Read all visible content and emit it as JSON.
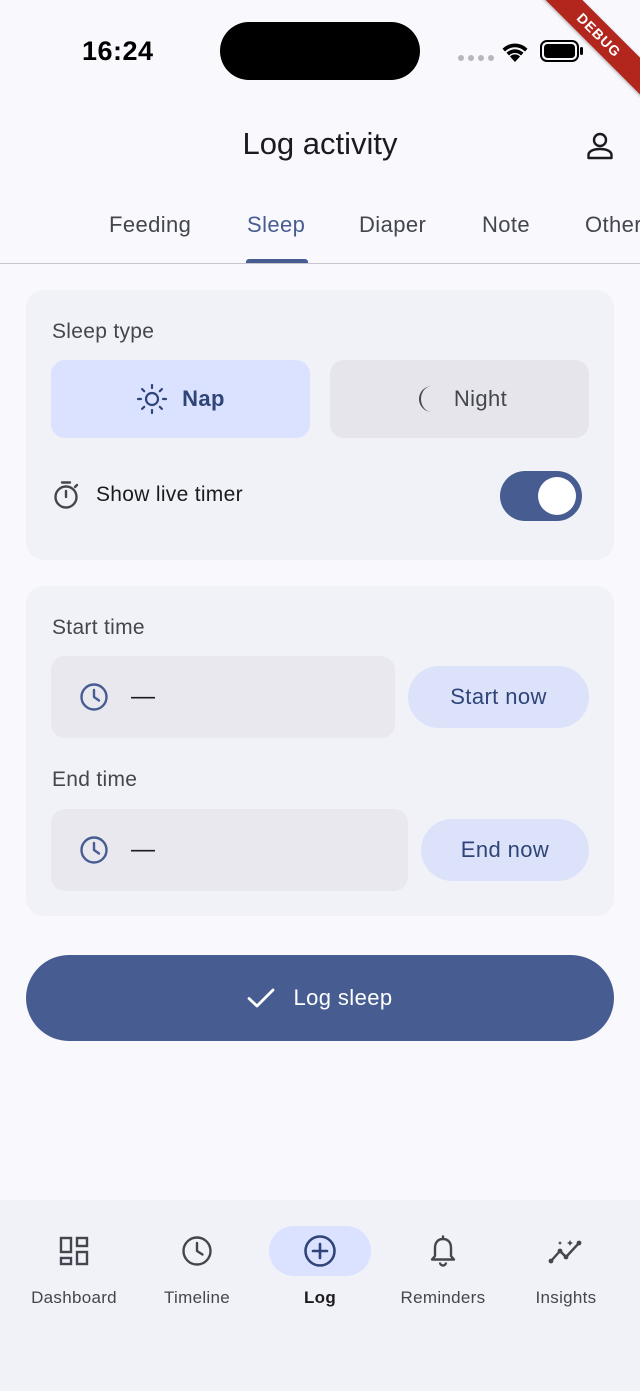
{
  "status_bar": {
    "time": "16:24",
    "debug_label": "DEBUG"
  },
  "app_bar": {
    "title": "Log activity"
  },
  "tabs": [
    {
      "label": "Feeding",
      "active": false
    },
    {
      "label": "Sleep",
      "active": true
    },
    {
      "label": "Diaper",
      "active": false
    },
    {
      "label": "Note",
      "active": false
    },
    {
      "label": "Other",
      "active": false
    }
  ],
  "sleep_type": {
    "label": "Sleep type",
    "options": [
      {
        "label": "Nap",
        "icon": "sun-icon",
        "selected": true
      },
      {
        "label": "Night",
        "icon": "moon-icon",
        "selected": false
      }
    ],
    "live_timer": {
      "label": "Show live timer",
      "enabled": true
    }
  },
  "times": {
    "start": {
      "label": "Start time",
      "value": "—",
      "button": "Start now"
    },
    "end": {
      "label": "End time",
      "value": "—",
      "button": "End now"
    }
  },
  "submit": {
    "label": "Log sleep"
  },
  "bottom_nav": [
    {
      "label": "Dashboard",
      "icon": "dashboard-icon",
      "active": false
    },
    {
      "label": "Timeline",
      "icon": "clock-icon",
      "active": false
    },
    {
      "label": "Log",
      "icon": "add-circle-icon",
      "active": true
    },
    {
      "label": "Reminders",
      "icon": "bell-icon",
      "active": false
    },
    {
      "label": "Insights",
      "icon": "insights-icon",
      "active": false
    }
  ],
  "colors": {
    "primary": "#475d92",
    "primary_container": "#dae2ff",
    "surface": "#f8f8fd",
    "card": "#f1f2f8"
  }
}
